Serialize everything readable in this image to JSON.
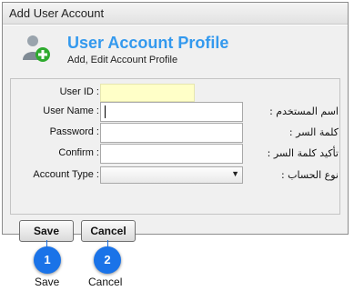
{
  "window": {
    "title": "Add User Account"
  },
  "header": {
    "icon": "add-user-icon",
    "title": "User Account Profile",
    "subtitle": "Add, Edit Account Profile"
  },
  "form": {
    "user_id": {
      "label": "User ID :",
      "value": "",
      "arabic": ""
    },
    "user_name": {
      "label": "User Name :",
      "value": "",
      "arabic": "اسم المستخدم :"
    },
    "password": {
      "label": "Password :",
      "value": "",
      "arabic": "كلمة السر :"
    },
    "confirm": {
      "label": "Confirm :",
      "value": "",
      "arabic": "تأكيد كلمة السر :"
    },
    "account_type": {
      "label": "Account Type :",
      "value": "",
      "arabic": "نوع الحساب :"
    }
  },
  "buttons": {
    "save": "Save",
    "cancel": "Cancel"
  },
  "callouts": [
    {
      "number": "1",
      "label": "Save"
    },
    {
      "number": "2",
      "label": "Cancel"
    }
  ],
  "colors": {
    "accent": "#3399ee",
    "callout": "#1a73e8",
    "user_id_bg": "#ffffc8"
  }
}
